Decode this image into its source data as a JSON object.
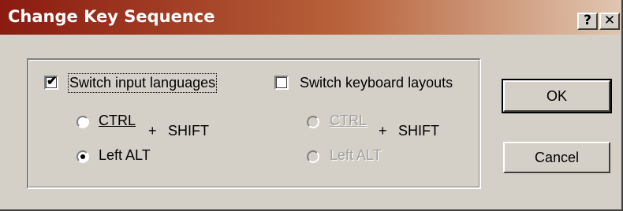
{
  "window": {
    "title": "Change Key Sequence",
    "help_button": "?",
    "close_button": "✕"
  },
  "input_languages": {
    "checkbox_label": "Switch input languages",
    "checked": true,
    "options": {
      "ctrl_label": "CTRL",
      "plus": "+",
      "shift_label": "SHIFT",
      "left_alt_label": "Left ALT"
    },
    "selected": "Left ALT"
  },
  "keyboard_layouts": {
    "checkbox_label": "Switch keyboard layouts",
    "checked": false,
    "options": {
      "ctrl_label": "CTRL",
      "plus": "+",
      "shift_label": "SHIFT",
      "left_alt_label": "Left ALT"
    },
    "enabled": false
  },
  "buttons": {
    "ok_label": "OK",
    "cancel_label": "Cancel"
  },
  "colors": {
    "dialog_face": "#d4d0c8",
    "titlebar_start": "#8b1a10",
    "titlebar_end": "#e0c6b0",
    "disabled_text": "#a0a0a0"
  }
}
